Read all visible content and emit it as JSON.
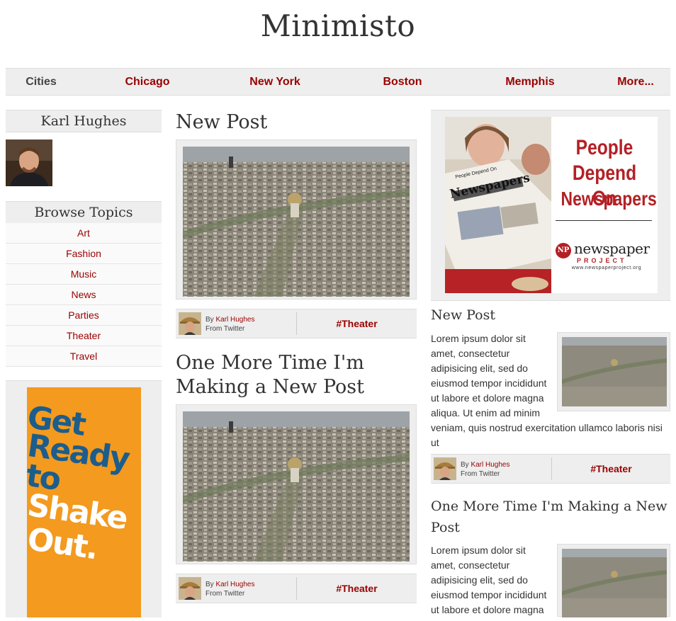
{
  "site": {
    "title": "Minimisto"
  },
  "nav": {
    "items": [
      {
        "label": "Cities"
      },
      {
        "label": "Chicago"
      },
      {
        "label": "New York"
      },
      {
        "label": "Boston"
      },
      {
        "label": "Memphis"
      },
      {
        "label": "More..."
      }
    ]
  },
  "author": {
    "name": "Karl Hughes"
  },
  "topics": {
    "heading": "Browse Topics",
    "items": [
      "Art",
      "Fashion",
      "Music",
      "News",
      "Parties",
      "Theater",
      "Travel"
    ]
  },
  "ads": {
    "left": {
      "lines": [
        "Get",
        "Ready",
        "to",
        "Shake",
        "Out."
      ]
    },
    "right": {
      "headline": [
        "People",
        "Depend On",
        "Newspapers."
      ],
      "logo_text": "newspaper",
      "logo_sub": "PROJECT",
      "logo_url": "www.newspaperproject.org",
      "paper_title": "Newspapers",
      "paper_top": "People Depend On"
    }
  },
  "posts": [
    {
      "title": "New Post",
      "by_prefix": "By",
      "author": "Karl Hughes",
      "source": "From Twitter",
      "tag": "#Theater"
    },
    {
      "title_lines": [
        "One More Time I'm",
        "Making a New Post"
      ],
      "by_prefix": "By",
      "author": "Karl Hughes",
      "source": "From Twitter",
      "tag": "#Theater"
    }
  ],
  "side_posts": [
    {
      "title": "New Post",
      "body": "Lorem ipsum dolor sit amet, consectetur adipisicing elit, sed do eiusmod tempor incididunt ut labore et dolore magna aliqua. Ut enim ad minim veniam, quis nostrud exercitation ullamco laboris nisi ut",
      "by_prefix": "By",
      "author": "Karl Hughes",
      "source": "From Twitter",
      "tag": "#Theater"
    },
    {
      "title_lines": [
        "One More Time I'm Making a New",
        "Post"
      ],
      "body": "Lorem ipsum dolor sit amet, consectetur adipisicing elit, sed do eiusmod tempor incididunt ut labore et dolore magna"
    }
  ],
  "colors": {
    "accent": "#990000",
    "panel": "#eeeeee",
    "ad_orange": "#f39a1f",
    "ad_blue": "#1c5d8c"
  }
}
